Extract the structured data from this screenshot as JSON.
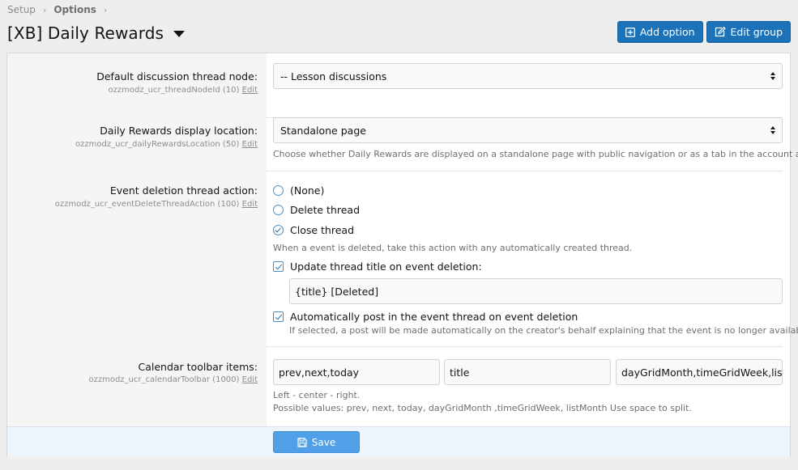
{
  "breadcrumb": {
    "items": [
      "Setup",
      "Options"
    ]
  },
  "page_title": "[XB] Daily Rewards",
  "header_buttons": {
    "add_option": "Add option",
    "edit_group": "Edit group"
  },
  "options": {
    "thread_node": {
      "label": "Default discussion thread node:",
      "hint": "ozzmodz_ucr_threadNodeId (10)",
      "edit": "Edit",
      "value": "-- Lesson discussions"
    },
    "display_location": {
      "label": "Daily Rewards display location:",
      "hint": "ozzmodz_ucr_dailyRewardsLocation (50)",
      "edit": "Edit",
      "value": "Standalone page",
      "explain": "Choose whether Daily Rewards are displayed on a standalone page with public navigation or as a tab in the account area."
    },
    "delete_action": {
      "label": "Event deletion thread action:",
      "hint": "ozzmodz_ucr_eventDeleteThreadAction (100)",
      "edit": "Edit",
      "radios": [
        "(None)",
        "Delete thread",
        "Close thread"
      ],
      "selected_index": 2,
      "explain": "When a event is deleted, take this action with any automatically created thread.",
      "update_title_label": "Update thread title on event deletion:",
      "update_title_checked": true,
      "title_template": "{title} [Deleted]",
      "auto_post_label": "Automatically post in the event thread on event deletion",
      "auto_post_checked": true,
      "auto_post_hint": "If selected, a post will be made automatically on the creator's behalf explaining that the event is no longer available."
    },
    "toolbar": {
      "label": "Calendar toolbar items:",
      "hint": "ozzmodz_ucr_calendarToolbar (1000)",
      "edit": "Edit",
      "left": "prev,next,today",
      "center": "title",
      "right": "dayGridMonth,timeGridWeek,listMonth",
      "explain_line1": "Left - center - right.",
      "explain_line2": "Possible values: prev, next, today, dayGridMonth ,timeGridWeek, listMonth Use space to split."
    }
  },
  "save_label": "Save",
  "colors": {
    "primary": "#1c72b8",
    "save": "#4fa0e6",
    "footer": "#edf4fa"
  }
}
